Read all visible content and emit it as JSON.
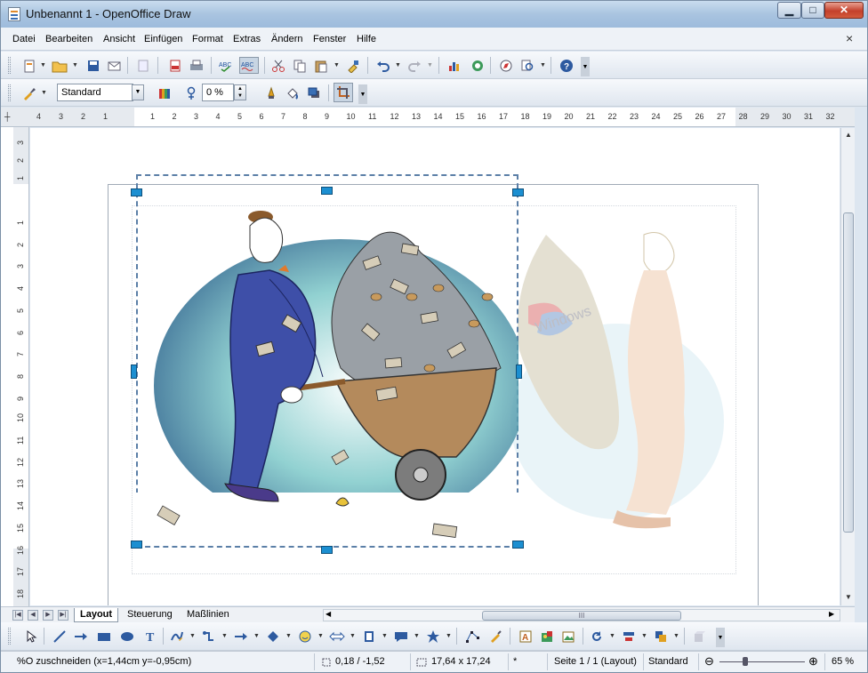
{
  "window": {
    "title": "Unbenannt 1 - OpenOffice Draw",
    "minimize": "▁",
    "maximize": "□",
    "close": "✕"
  },
  "menu": [
    "Datei",
    "Bearbeiten",
    "Ansicht",
    "Einfügen",
    "Format",
    "Extras",
    "Ändern",
    "Fenster",
    "Hilfe"
  ],
  "doc_close": "×",
  "toolbar2": {
    "style_value": "Standard",
    "transparency_value": "0 %"
  },
  "hruler_ticks": [
    "4",
    "3",
    "2",
    "1",
    "1",
    "2",
    "3",
    "4",
    "5",
    "6",
    "7",
    "8",
    "9",
    "10",
    "11",
    "12",
    "13",
    "14",
    "15",
    "16",
    "17",
    "18",
    "19",
    "20",
    "21",
    "22",
    "23",
    "24",
    "25",
    "26",
    "27",
    "28",
    "29",
    "30",
    "31",
    "32"
  ],
  "vruler_ticks": [
    "3",
    "2",
    "1",
    "1",
    "2",
    "3",
    "4",
    "5",
    "6",
    "7",
    "8",
    "9",
    "10",
    "11",
    "12",
    "13",
    "14",
    "15",
    "16",
    "17",
    "18"
  ],
  "layer_tabs": [
    "Layout",
    "Steuerung",
    "Maßlinien"
  ],
  "hscroll_grip": "III",
  "status": {
    "message": "%O zuschneiden (x=1,44cm y=-0,95cm)",
    "position": "0,18 / -1,52",
    "size": "17,64 x 17,24",
    "modified": "*",
    "page": "Seite 1 / 1 (Layout)",
    "style": "Standard",
    "zoom": "65 %",
    "zoom_minus": "⊖",
    "zoom_plus": "⊕"
  },
  "colors": {
    "handle": "#1c8fd1",
    "selection": "#5b7fa7",
    "canvas": "#ffffff",
    "chrome": "#dde6f0"
  },
  "image_text": "Windows"
}
